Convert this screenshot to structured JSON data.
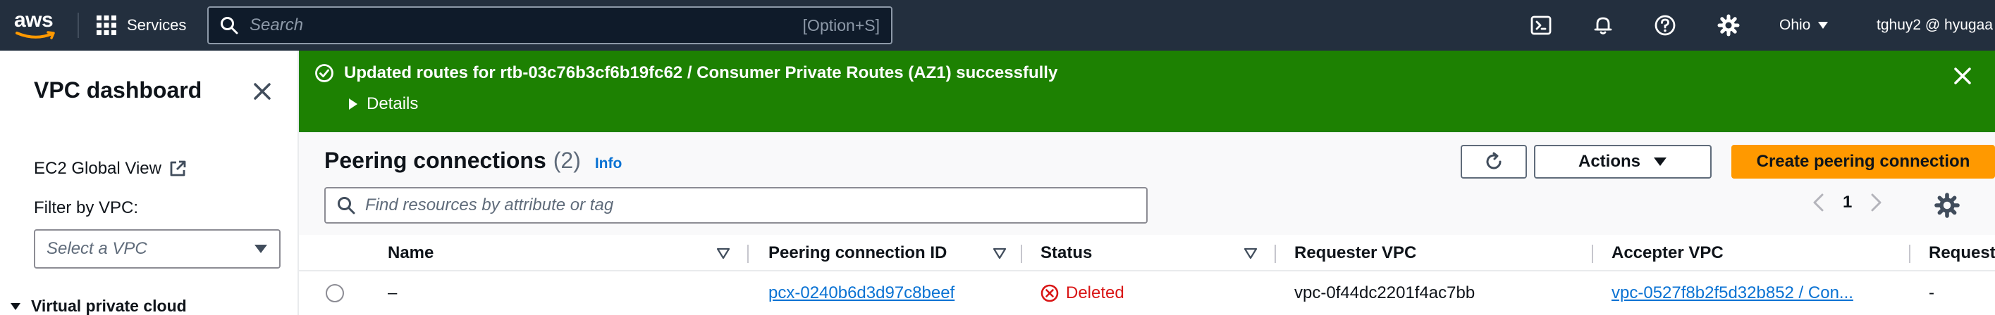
{
  "topnav": {
    "logo_text": "aws",
    "services_label": "Services",
    "search_placeholder": "Search",
    "search_shortcut": "[Option+S]",
    "region": "Ohio",
    "account": "tghuy2 @ hyugaa"
  },
  "sidebar": {
    "title": "VPC dashboard",
    "ec2_global_view": "EC2 Global View",
    "filter_label": "Filter by VPC:",
    "select_placeholder": "Select a VPC",
    "section_label": "Virtual private cloud"
  },
  "flash": {
    "message": "Updated routes for rtb-03c76b3cf6b19fc62 / Consumer Private Routes (AZ1) successfully",
    "details_label": "Details"
  },
  "main": {
    "title": "Peering connections",
    "count": "(2)",
    "info": "Info",
    "actions_label": "Actions",
    "create_label": "Create peering connection",
    "filter_placeholder": "Find resources by attribute or tag",
    "page_number": "1",
    "columns": {
      "name": "Name",
      "peering_id": "Peering connection ID",
      "status": "Status",
      "requester_vpc": "Requester VPC",
      "accepter_vpc": "Accepter VPC",
      "requester_short": "Request"
    },
    "rows": [
      {
        "name": "–",
        "peering_id": "pcx-0240b6d3d97c8beef",
        "status": "Deleted",
        "requester_vpc": "vpc-0f44dc2201f4ac7bb",
        "accepter_vpc": "vpc-0527f8b2f5d32b852 / Con...",
        "requester_extra": "-"
      }
    ]
  },
  "colors": {
    "nav_bg": "#232f3e",
    "success_green": "#1d8102",
    "primary_orange": "#ff9900",
    "link_blue": "#0972d3",
    "error_red": "#d91515"
  }
}
